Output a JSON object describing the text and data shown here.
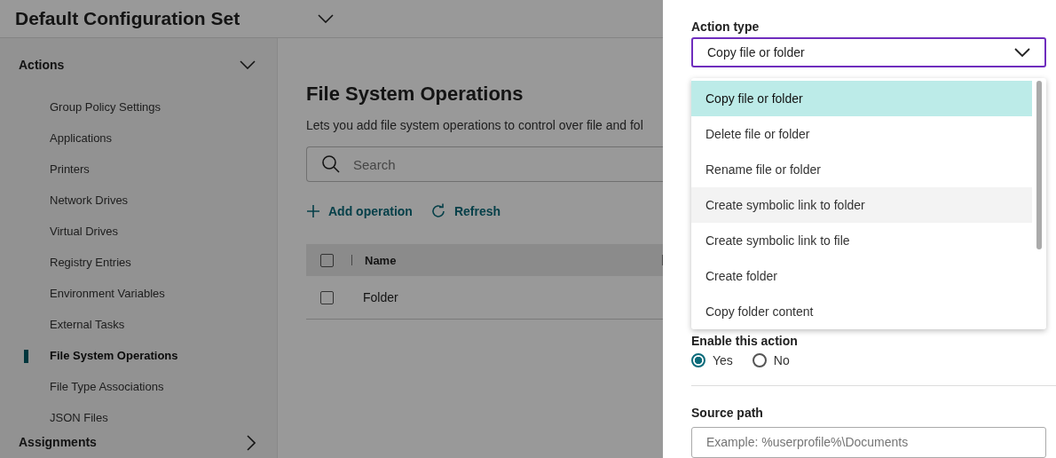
{
  "header": {
    "title": "Default Configuration Set"
  },
  "sidebar": {
    "section": "Actions",
    "expanded": true,
    "items": [
      {
        "label": "Group Policy Settings",
        "selected": false
      },
      {
        "label": "Applications",
        "selected": false
      },
      {
        "label": "Printers",
        "selected": false
      },
      {
        "label": "Network Drives",
        "selected": false
      },
      {
        "label": "Virtual Drives",
        "selected": false
      },
      {
        "label": "Registry Entries",
        "selected": false
      },
      {
        "label": "Environment Variables",
        "selected": false
      },
      {
        "label": "External Tasks",
        "selected": false
      },
      {
        "label": "File System Operations",
        "selected": true
      },
      {
        "label": "File Type Associations",
        "selected": false
      },
      {
        "label": "JSON Files",
        "selected": false
      }
    ],
    "next_section": "Assignments"
  },
  "main": {
    "title": "File System Operations",
    "description": "Lets you add file system operations to control over file and fol",
    "search": {
      "placeholder": "Search"
    },
    "toolbar": [
      "Add operation",
      "Refresh"
    ],
    "table": {
      "all_checked": false,
      "columns": [
        "Name"
      ],
      "rows": [
        {
          "name": "Folder",
          "checked": false
        }
      ]
    }
  },
  "panel": {
    "action_type": {
      "label": "Action type",
      "value": "Copy file or folder",
      "options": [
        {
          "label": "Copy file or folder",
          "selected": true,
          "hovered": false
        },
        {
          "label": "Delete file or folder",
          "selected": false,
          "hovered": false
        },
        {
          "label": "Rename file or folder",
          "selected": false,
          "hovered": false
        },
        {
          "label": "Create symbolic link to folder",
          "selected": false,
          "hovered": true
        },
        {
          "label": "Create symbolic link to file",
          "selected": false,
          "hovered": false
        },
        {
          "label": "Create folder",
          "selected": false,
          "hovered": false
        },
        {
          "label": "Copy folder content",
          "selected": false,
          "hovered": false
        }
      ]
    },
    "enable": {
      "label": "Enable this action",
      "options": [
        {
          "label": "Yes",
          "selected": true
        },
        {
          "label": "No",
          "selected": false
        }
      ]
    },
    "source_path": {
      "label": "Source path",
      "placeholder": "Example: %userprofile%\\Documents"
    }
  }
}
